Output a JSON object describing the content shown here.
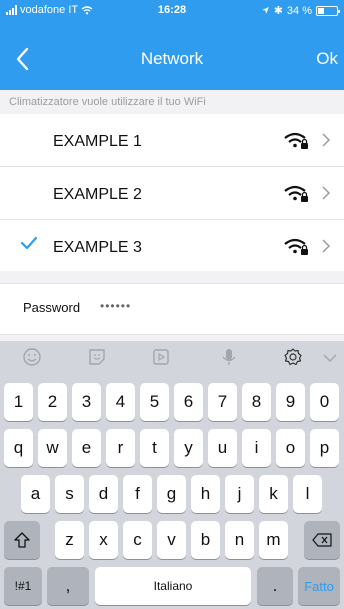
{
  "status": {
    "carrier": "vodafone IT",
    "time": "16:28",
    "battery": "34 %",
    "battery_level": 0.34
  },
  "nav": {
    "title": "Network",
    "ok_label": "Ok"
  },
  "hint": "Climatizzatore vuole utilizzare il tuo WiFi",
  "networks": [
    {
      "name": "EXAMPLE 1",
      "selected": false
    },
    {
      "name": "EXAMPLE 2",
      "selected": false
    },
    {
      "name": "EXAMPLE 3",
      "selected": true
    }
  ],
  "password": {
    "label": "Password",
    "value": "••••••"
  },
  "keyboard": {
    "row1": [
      "1",
      "2",
      "3",
      "4",
      "5",
      "6",
      "7",
      "8",
      "9",
      "0"
    ],
    "row2": [
      "q",
      "w",
      "e",
      "r",
      "t",
      "y",
      "u",
      "i",
      "o",
      "p"
    ],
    "row3": [
      "a",
      "s",
      "d",
      "f",
      "g",
      "h",
      "j",
      "k",
      "l"
    ],
    "row4": [
      "z",
      "x",
      "c",
      "v",
      "b",
      "n",
      "m"
    ],
    "sym_label": "!#1",
    "comma": ",",
    "space_label": "Italiano",
    "period": ".",
    "done_label": "Fatto"
  },
  "colors": {
    "accent": "#2f9cf0"
  },
  "icons": [
    "wifi-lock-icon",
    "chevron-right-icon",
    "checkmark-icon",
    "back-arrow-icon",
    "emoji-icon",
    "sticker-icon",
    "gif-icon",
    "microphone-icon",
    "settings-icon",
    "collapse-icon",
    "shift-icon",
    "backspace-icon"
  ]
}
